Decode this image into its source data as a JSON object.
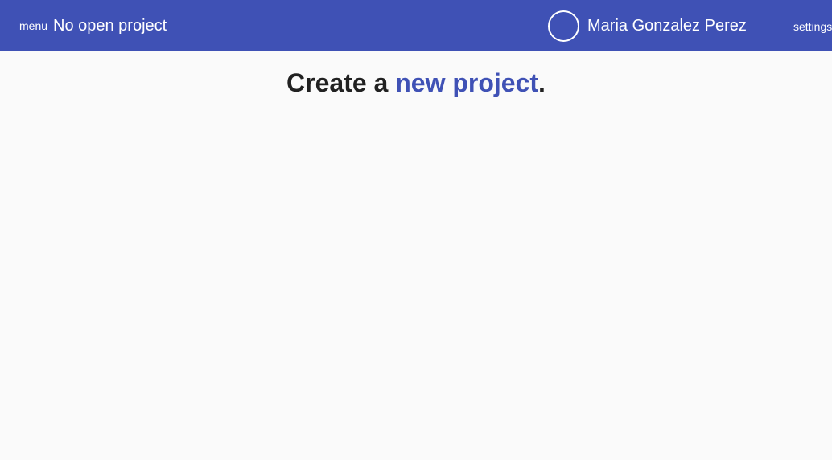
{
  "header": {
    "menu_label": "menu",
    "project_title": "No open project",
    "user_name": "Maria Gonzalez Perez",
    "settings_label": "settings",
    "avatar_icon": "avatar-circle-icon"
  },
  "main": {
    "headline_prefix": "Create a ",
    "headline_link": "new project",
    "headline_suffix": "."
  },
  "colors": {
    "primary": "#3f51b5",
    "background": "#fafafa",
    "text": "#212121"
  }
}
